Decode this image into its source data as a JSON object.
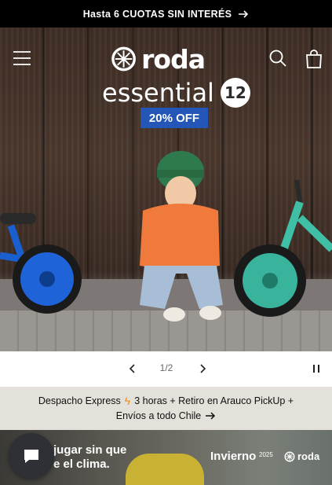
{
  "announcement": {
    "text": "Hasta 6 CUOTAS SIN INTERÉS",
    "icon": "arrow-right-icon"
  },
  "header": {
    "menu_icon": "menu-icon",
    "logo_text": "roda",
    "search_icon": "search-icon",
    "cart_icon": "cart-icon"
  },
  "hero": {
    "product_name": "essential",
    "product_size": "12",
    "discount": "20% OFF"
  },
  "slider": {
    "counter": "1/2",
    "prev_icon": "chevron-left-icon",
    "next_icon": "chevron-right-icon",
    "pause_icon": "pause-icon"
  },
  "shipping": {
    "line1_a": "Despacho Express",
    "line1_b": "3 horas + Retiro en Arauco PickUp +",
    "line2": "Envíos a todo Chile",
    "bolt_icon": "lightning-icon"
  },
  "banner": {
    "text_line1": "jugar sin que",
    "text_line2": "e el clima.",
    "season": "Invierno",
    "year": "2025",
    "logo_text": "roda"
  },
  "chat": {
    "icon": "chat-bubble-icon"
  },
  "colors": {
    "announcement_bg": "#000000",
    "discount_bg": "#2456b8",
    "shipping_bg": "#e4e0da",
    "bolt": "#f08c1a"
  }
}
